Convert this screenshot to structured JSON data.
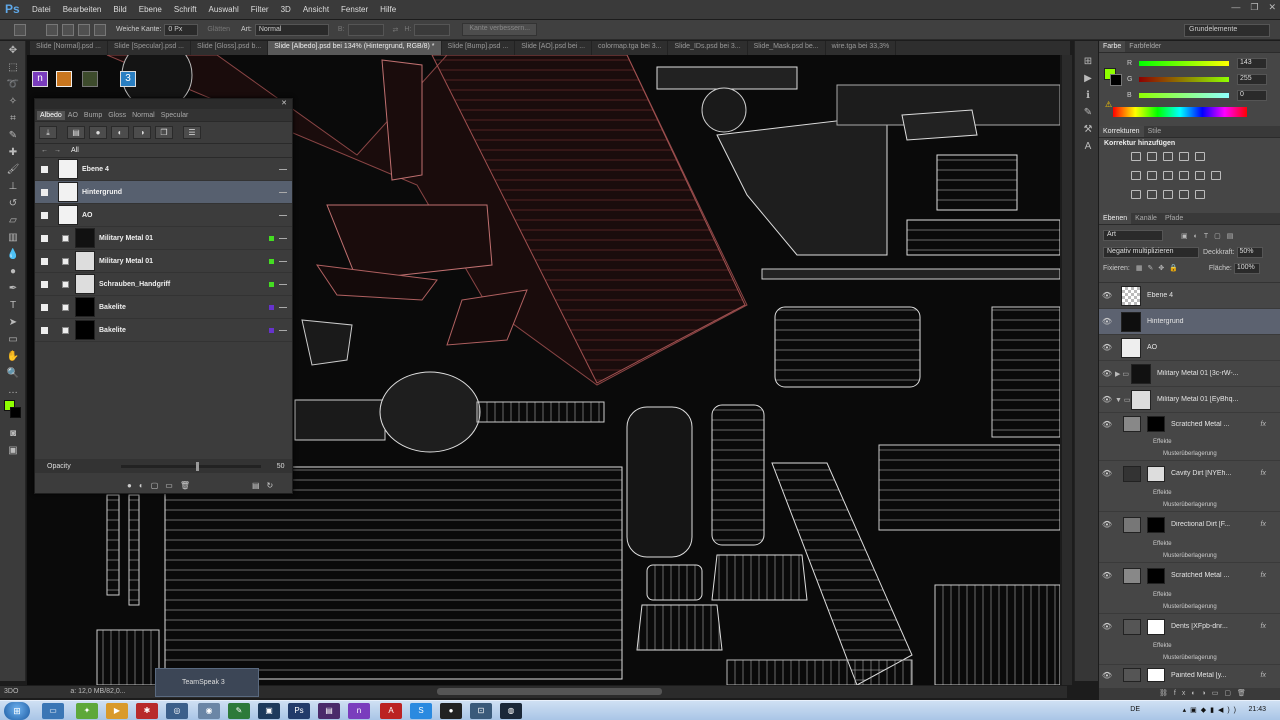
{
  "menubar": {
    "logo": "Ps",
    "items": [
      "Datei",
      "Bearbeiten",
      "Bild",
      "Ebene",
      "Schrift",
      "Auswahl",
      "Filter",
      "3D",
      "Ansicht",
      "Fenster",
      "Hilfe"
    ],
    "win_controls": [
      "—",
      "❐",
      "✕"
    ]
  },
  "options": {
    "weiche_label": "Weiche Kante:",
    "weiche_value": "0 Px",
    "glaetten": "Glätten",
    "art_label": "Art:",
    "art_value": "Normal",
    "b_label": "B:",
    "h_label": "H:",
    "refine_button": "Kante verbessern...",
    "workspace": "Grundelemente"
  },
  "tabs": [
    "Slide [Normal].psd ...",
    "Slide [Specular].psd ...",
    "Slide [Gloss].psd b...",
    "Slide [Albedo].psd bei 134% (Hintergrund, RGB/8) *",
    "Slide [Bump].psd ...",
    "Slide [AO].psd bei ...",
    "colormap.tga bei 3...",
    "Slide_IDs.psd bei 3...",
    "Slide_Mask.psd be...",
    "wire.tga bei 33,3%"
  ],
  "float": {
    "tabs": [
      "Albedo",
      "AO",
      "Bump",
      "Gloss",
      "Normal",
      "Specular"
    ],
    "breadcrumb": "All",
    "layers": [
      {
        "name": "Ebene 4",
        "dot": ""
      },
      {
        "name": "Hintergrund",
        "dot": ""
      },
      {
        "name": "AO",
        "dot": ""
      },
      {
        "name": "Military Metal 01",
        "dot": "#44dd22"
      },
      {
        "name": "Military Metal 01",
        "dot": "#44dd22"
      },
      {
        "name": "Schrauben_Handgriff",
        "dot": "#44dd22"
      },
      {
        "name": "Bakelite",
        "dot": "#6633cc"
      },
      {
        "name": "Bakelite",
        "dot": "#6633cc"
      }
    ],
    "opacity_label": "Opacity",
    "opacity_value": "50"
  },
  "color_panel": {
    "tabs": [
      "Farbe",
      "Farbfelder"
    ],
    "r_label": "R",
    "g_label": "G",
    "b_label": "B",
    "r": "143",
    "g": "255",
    "b": "0",
    "fg_color": "#8fff00"
  },
  "adjust_panel": {
    "tabs": [
      "Korrekturen",
      "Stile"
    ],
    "title": "Korrektur hinzufügen"
  },
  "layers_panel": {
    "tabs": [
      "Ebenen",
      "Kanäle",
      "Pfade"
    ],
    "filter": "Art",
    "blend": "Negativ multiplizieren",
    "deckkraft_label": "Deckkraft:",
    "deckkraft": "50%",
    "fixieren": "Fixieren:",
    "flaeche_label": "Fläche:",
    "flaeche": "100%",
    "layers": [
      {
        "name": "Ebene 4",
        "type": "layer"
      },
      {
        "name": "Hintergrund",
        "type": "layer",
        "selected": true
      },
      {
        "name": "AO",
        "type": "layer"
      },
      {
        "name": "Military Metal 01 [3c-rW-...",
        "type": "group"
      },
      {
        "name": "Military Metal 01 [EyBhq...",
        "type": "group"
      },
      {
        "name": "Scratched Metal ...",
        "type": "sub",
        "fx": true
      },
      {
        "name": "Cavity Dirt [NYEh...",
        "type": "sub",
        "fx": true
      },
      {
        "name": "Directional Dirt [F...",
        "type": "sub",
        "fx": true
      },
      {
        "name": "Scratched Metal ...",
        "type": "sub",
        "fx": true
      },
      {
        "name": "Dents [XFpb-dnr...",
        "type": "sub",
        "fx": true
      },
      {
        "name": "Painted Metal [y...",
        "type": "sub",
        "fx": true
      }
    ],
    "effekte": "Effekte",
    "muster": "Musterüberlagerung"
  },
  "status": {
    "zoom": "3DO",
    "doc": "a: 12,0 MB/82,0..."
  },
  "tooltip": "TeamSpeak 3",
  "taskbar": {
    "lang": "DE",
    "time": "21:43"
  }
}
